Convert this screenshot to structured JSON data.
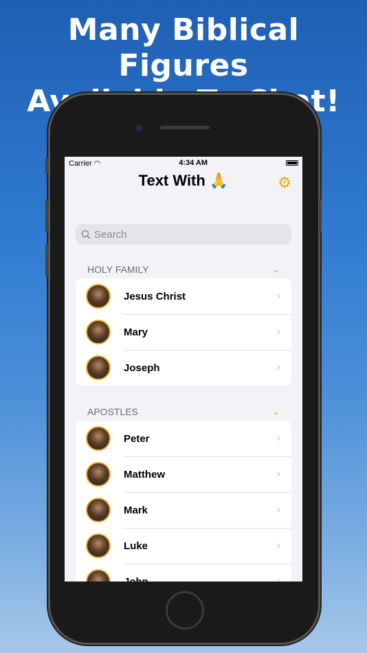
{
  "headline": [
    "Many Biblical Figures",
    "Available To Chat!"
  ],
  "status": {
    "carrier": "Carrier",
    "time": "4:34 AM"
  },
  "header": {
    "title": "Text With 🙏",
    "settings_icon": "gear-icon"
  },
  "search": {
    "placeholder": "Search"
  },
  "accent": "#f5a800",
  "sections": [
    {
      "title": "HOLY FAMILY",
      "items": [
        "Jesus Christ",
        "Mary",
        "Joseph"
      ]
    },
    {
      "title": "APOSTLES",
      "items": [
        "Peter",
        "Matthew",
        "Mark",
        "Luke",
        "John"
      ]
    }
  ]
}
